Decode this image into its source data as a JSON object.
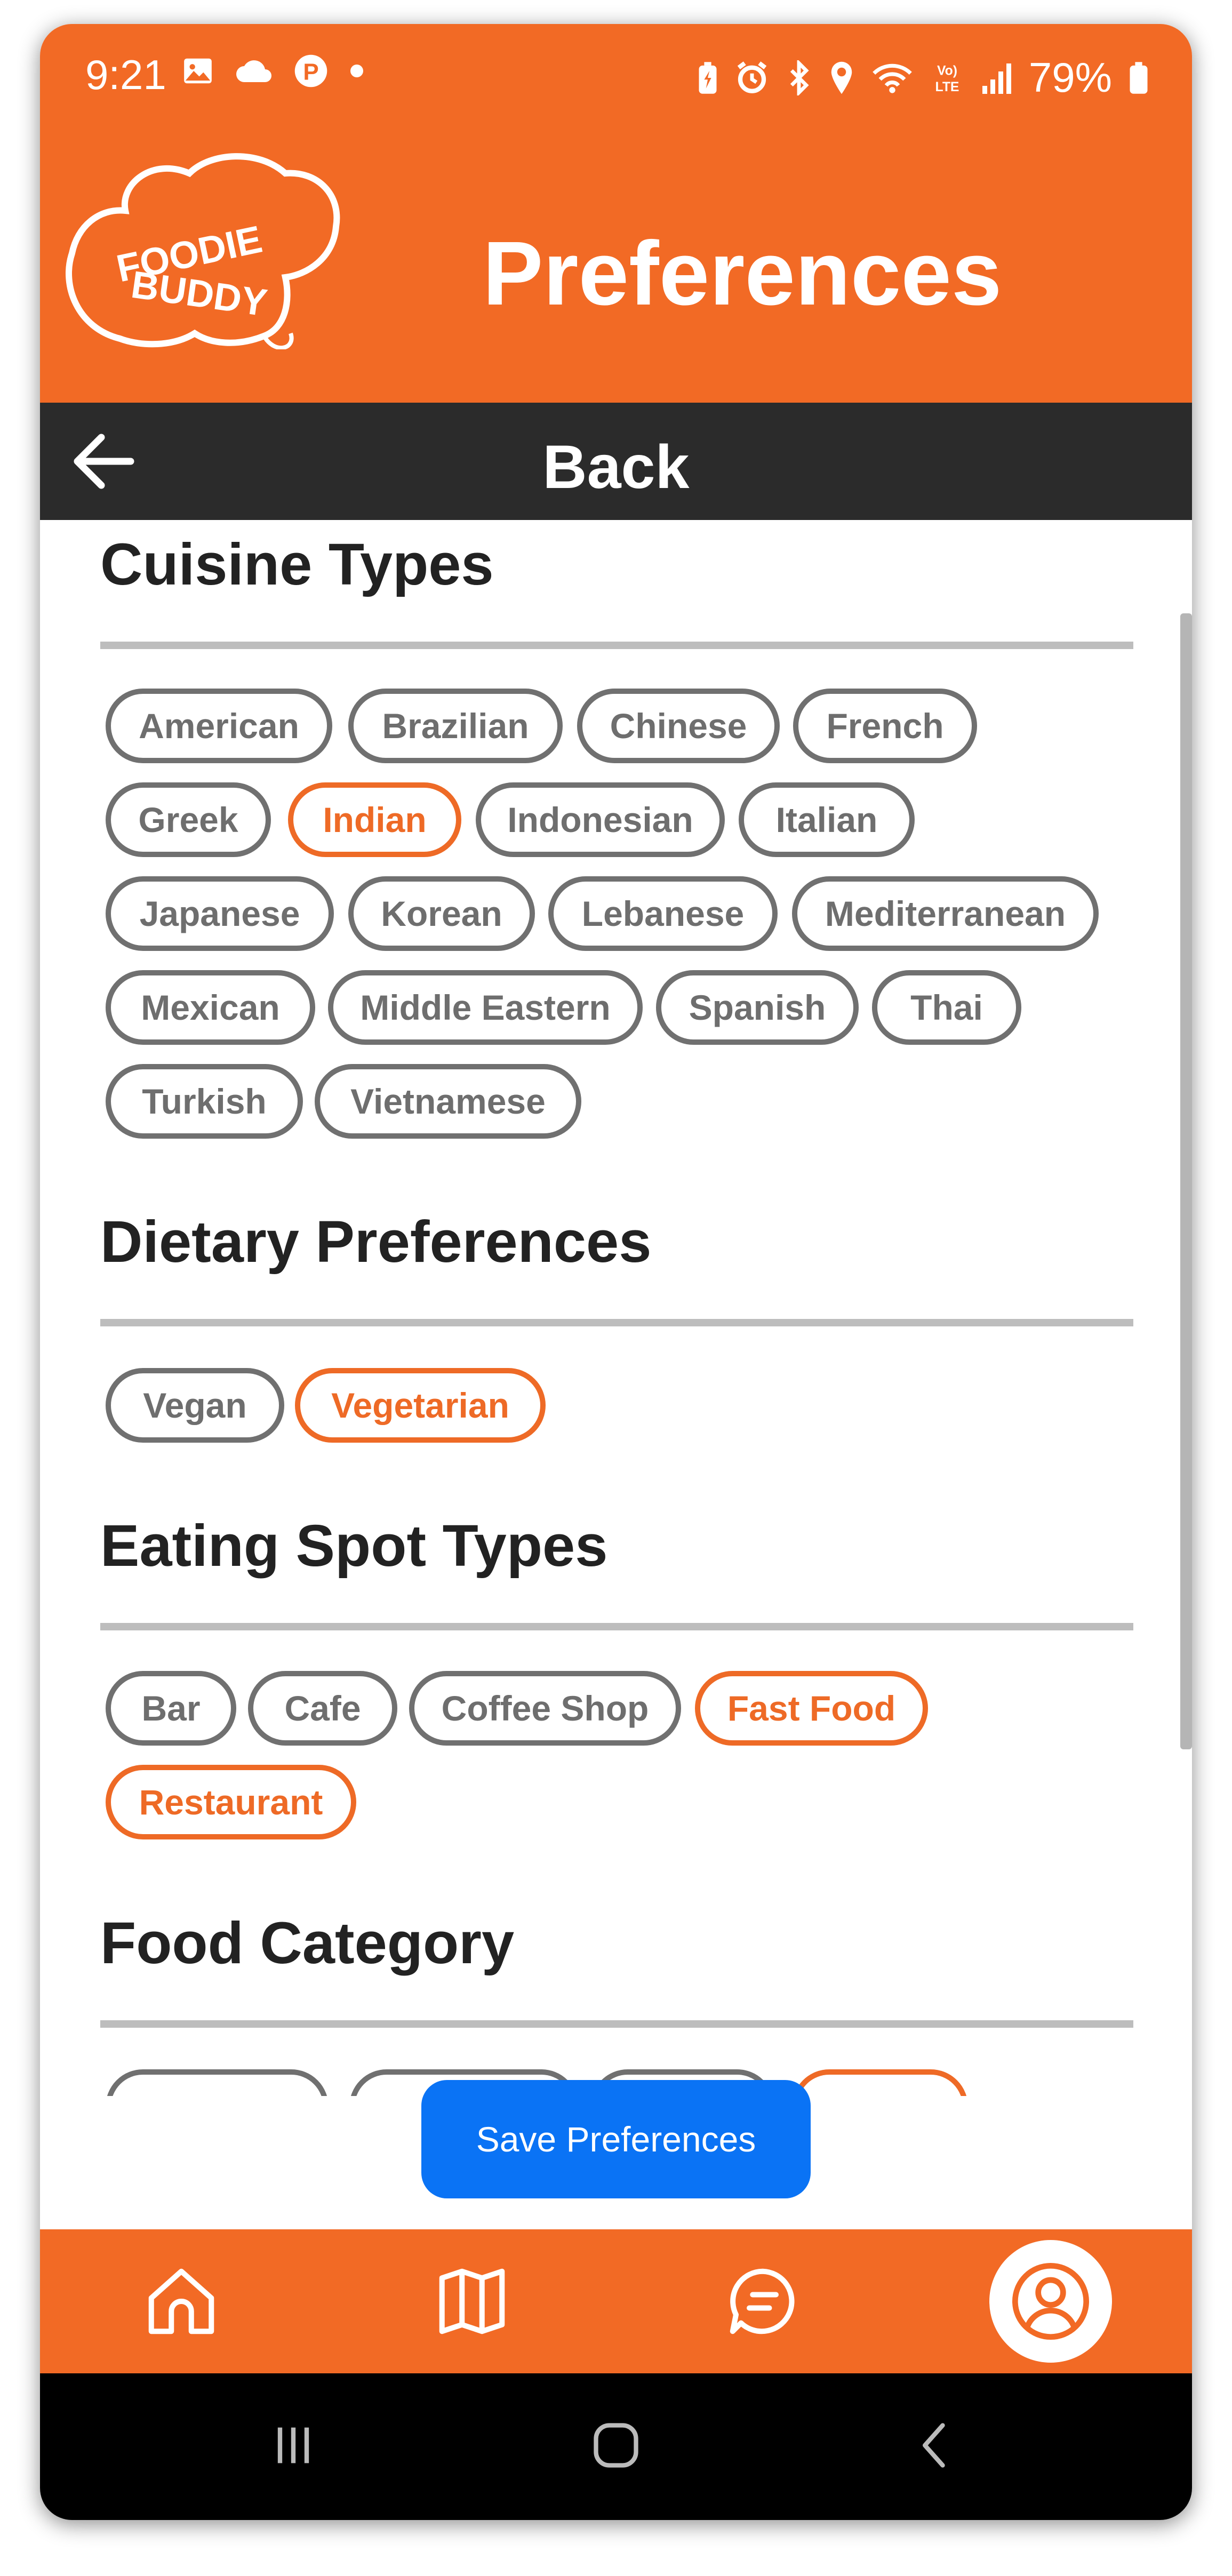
{
  "status_bar": {
    "time": "9:21",
    "battery": "79%",
    "left_icons": [
      "image-icon",
      "cloud-icon",
      "pinterest-icon",
      "dot-icon"
    ],
    "right_icons": [
      "battery-saver-icon",
      "alarm-icon",
      "bluetooth-icon",
      "location-icon",
      "wifi-icon",
      "volte-icon",
      "signal-icon",
      "battery-icon"
    ]
  },
  "header": {
    "logo_line1": "FOODIE",
    "logo_line2": "BUDDY",
    "title": "Preferences"
  },
  "back_bar": {
    "label": "Back"
  },
  "sections": {
    "cuisine": {
      "title": "Cuisine Types",
      "chips": [
        {
          "label": "American",
          "selected": false
        },
        {
          "label": "Brazilian",
          "selected": false
        },
        {
          "label": "Chinese",
          "selected": false
        },
        {
          "label": "French",
          "selected": false
        },
        {
          "label": "Greek",
          "selected": false
        },
        {
          "label": "Indian",
          "selected": true
        },
        {
          "label": "Indonesian",
          "selected": false
        },
        {
          "label": "Italian",
          "selected": false
        },
        {
          "label": "Japanese",
          "selected": false
        },
        {
          "label": "Korean",
          "selected": false
        },
        {
          "label": "Lebanese",
          "selected": false
        },
        {
          "label": "Mediterranean",
          "selected": false
        },
        {
          "label": "Mexican",
          "selected": false
        },
        {
          "label": "Middle Eastern",
          "selected": false
        },
        {
          "label": "Spanish",
          "selected": false
        },
        {
          "label": "Thai",
          "selected": false
        },
        {
          "label": "Turkish",
          "selected": false
        },
        {
          "label": "Vietnamese",
          "selected": false
        }
      ]
    },
    "dietary": {
      "title": "Dietary Preferences",
      "chips": [
        {
          "label": "Vegan",
          "selected": false
        },
        {
          "label": "Vegetarian",
          "selected": true
        }
      ]
    },
    "eating_spot": {
      "title": "Eating Spot Types",
      "chips": [
        {
          "label": "Bar",
          "selected": false
        },
        {
          "label": "Cafe",
          "selected": false
        },
        {
          "label": "Coffee Shop",
          "selected": false
        },
        {
          "label": "Fast Food",
          "selected": true
        },
        {
          "label": "Restaurant",
          "selected": true
        }
      ]
    },
    "food_category": {
      "title": "Food Category"
    }
  },
  "save_button": {
    "label": "Save Preferences"
  },
  "tab_bar": {
    "tabs": [
      {
        "icon": "home-icon",
        "active": false
      },
      {
        "icon": "map-icon",
        "active": false
      },
      {
        "icon": "chat-icon",
        "active": false
      },
      {
        "icon": "profile-icon",
        "active": true
      }
    ]
  },
  "colors": {
    "brand_orange": "#F26A25",
    "selected_chip": "#EE6A26",
    "unselected_chip": "#707070",
    "save_button": "#0A73F5",
    "back_bar": "#2B2B2B"
  }
}
